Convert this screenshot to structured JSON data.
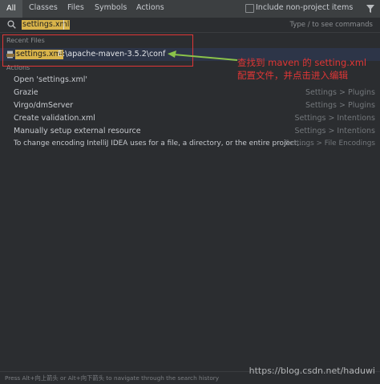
{
  "tabs": [
    {
      "label": "All",
      "active": true
    },
    {
      "label": "Classes"
    },
    {
      "label": "Files"
    },
    {
      "label": "Symbols"
    },
    {
      "label": "Actions"
    }
  ],
  "filters": {
    "include_label": "Include non-project items",
    "include_checked": false
  },
  "search": {
    "value": "settings.xml",
    "hint": "Type / to see commands"
  },
  "recent_files": {
    "heading": "Recent Files",
    "items": [
      {
        "name": "settings.xml",
        "path": "E:\\apache-maven-3.5.2\\conf"
      }
    ]
  },
  "actions": {
    "heading": "Actions",
    "items": [
      {
        "label": "Open 'settings.xml'",
        "category": ""
      },
      {
        "label": "Grazie",
        "category": "Settings > Plugins"
      },
      {
        "label": "Virgo/dmServer",
        "category": "Settings > Plugins"
      },
      {
        "label": "Create validation.xml",
        "category": "Settings > Intentions"
      },
      {
        "label": "Manually setup external resource",
        "category": "Settings > Intentions"
      },
      {
        "label": "To change encoding IntelliJ IDEA uses for a file, a directory, or the entire project,...",
        "category": "Settings > File Encodings"
      }
    ]
  },
  "annotation": {
    "text": "查找到 maven 的 setting.xml 配置文件，并点击进入编辑",
    "color": "#e03636"
  },
  "footer": {
    "hint": "Press Alt+向上箭头 or Alt+向下箭头 to navigate through the search history"
  },
  "watermark": "https://blog.csdn.net/haduwi",
  "icons": {
    "search": "search-icon",
    "filter": "filter-icon",
    "file": "xml-file-icon"
  },
  "colors": {
    "match_highlight": "#d8b34a",
    "selection": "#2d3548",
    "annotation": "#e03636"
  }
}
